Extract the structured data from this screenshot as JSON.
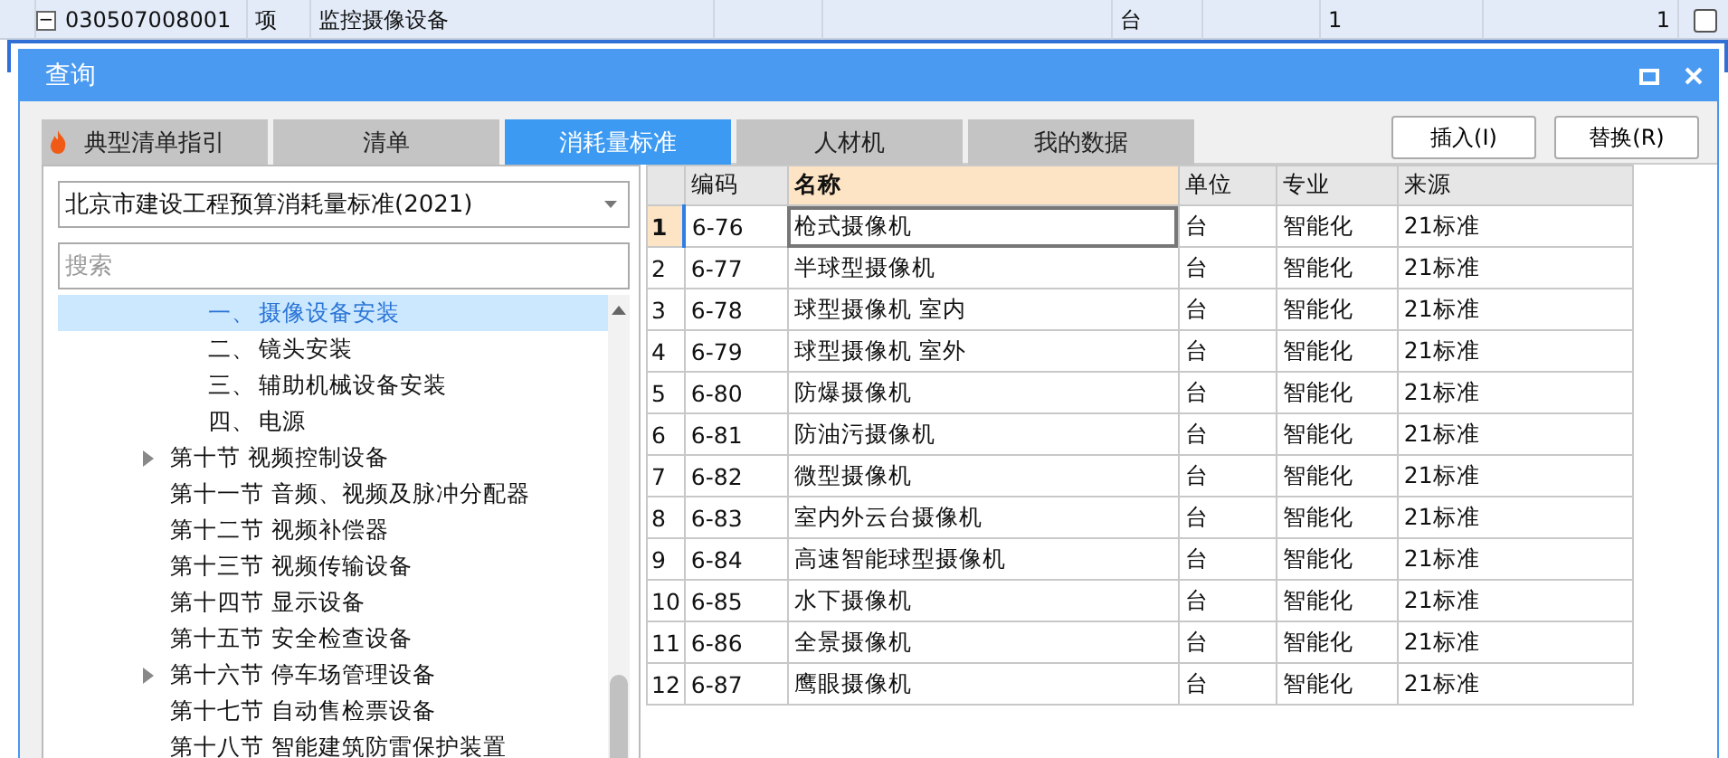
{
  "sheet_row": {
    "toggle": "−",
    "code": "030507008001",
    "type": "项",
    "name": "监控摄像设备",
    "unit": "台",
    "quantity_1": "1",
    "quantity_2": "1",
    "checked": false
  },
  "dialog": {
    "title": "查询",
    "tabs": [
      {
        "label": "典型清单指引",
        "selected": false,
        "kind": "hot"
      },
      {
        "label": "清单",
        "selected": false,
        "kind": "plain"
      },
      {
        "label": "消耗量标准",
        "selected": true,
        "kind": "plain"
      },
      {
        "label": "人材机",
        "selected": false,
        "kind": "plain"
      },
      {
        "label": "我的数据",
        "selected": false,
        "kind": "plain"
      }
    ],
    "buttons": [
      "插入(I)",
      "替换(R)"
    ],
    "standard_select": {
      "value": "北京市建设工程预算消耗量标准(2021)"
    },
    "search": {
      "placeholder": "搜索"
    },
    "tree": {
      "subitems": [
        {
          "number": "一、",
          "label": "摄像设备安装",
          "selected": true
        },
        {
          "number": "二、",
          "label": "镜头安装",
          "selected": false
        },
        {
          "number": "三、",
          "label": "辅助机械设备安装",
          "selected": false
        },
        {
          "number": "四、",
          "label": "电源",
          "selected": false
        }
      ],
      "sections": [
        {
          "label": "第十节 视频控制设备",
          "has_children": true,
          "selected": false
        },
        {
          "label": "第十一节 音频、视频及脉冲分配器",
          "has_children": false,
          "selected": false
        },
        {
          "label": "第十二节 视频补偿器",
          "has_children": false,
          "selected": false
        },
        {
          "label": "第十三节 视频传输设备",
          "has_children": false,
          "selected": false
        },
        {
          "label": "第十四节 显示设备",
          "has_children": false,
          "selected": false
        },
        {
          "label": "第十五节 安全检查设备",
          "has_children": false,
          "selected": false
        },
        {
          "label": "第十六节 停车场管理设备",
          "has_children": true,
          "selected": false
        },
        {
          "label": "第十七节 自动售检票设备",
          "has_children": false,
          "selected": false
        },
        {
          "label": "第十八节 智能建筑防雷保护装置",
          "has_children": false,
          "selected": false
        }
      ]
    },
    "table": {
      "columns": [
        {
          "label": "编码",
          "selected": false
        },
        {
          "label": "名称",
          "selected": true
        },
        {
          "label": "单位",
          "selected": false
        },
        {
          "label": "专业",
          "selected": false
        },
        {
          "label": "来源",
          "selected": false
        }
      ],
      "rows": [
        {
          "index": "1",
          "cells": [
            "6-76",
            "枪式摄像机",
            "台",
            "智能化",
            "21标准"
          ],
          "selected": true
        },
        {
          "index": "2",
          "cells": [
            "6-77",
            "半球型摄像机",
            "台",
            "智能化",
            "21标准"
          ],
          "selected": false
        },
        {
          "index": "3",
          "cells": [
            "6-78",
            "球型摄像机 室内",
            "台",
            "智能化",
            "21标准"
          ],
          "selected": false
        },
        {
          "index": "4",
          "cells": [
            "6-79",
            "球型摄像机 室外",
            "台",
            "智能化",
            "21标准"
          ],
          "selected": false
        },
        {
          "index": "5",
          "cells": [
            "6-80",
            "防爆摄像机",
            "台",
            "智能化",
            "21标准"
          ],
          "selected": false
        },
        {
          "index": "6",
          "cells": [
            "6-81",
            "防油污摄像机",
            "台",
            "智能化",
            "21标准"
          ],
          "selected": false
        },
        {
          "index": "7",
          "cells": [
            "6-82",
            "微型摄像机",
            "台",
            "智能化",
            "21标准"
          ],
          "selected": false
        },
        {
          "index": "8",
          "cells": [
            "6-83",
            "室内外云台摄像机",
            "台",
            "智能化",
            "21标准"
          ],
          "selected": false
        },
        {
          "index": "9",
          "cells": [
            "6-84",
            "高速智能球型摄像机",
            "台",
            "智能化",
            "21标准"
          ],
          "selected": false
        },
        {
          "index": "10",
          "cells": [
            "6-85",
            "水下摄像机",
            "台",
            "智能化",
            "21标准"
          ],
          "selected": false
        },
        {
          "index": "11",
          "cells": [
            "6-86",
            "全景摄像机",
            "台",
            "智能化",
            "21标准"
          ],
          "selected": false
        },
        {
          "index": "12",
          "cells": [
            "6-87",
            "鹰眼摄像机",
            "台",
            "智能化",
            "21标准"
          ],
          "selected": false
        }
      ]
    }
  }
}
